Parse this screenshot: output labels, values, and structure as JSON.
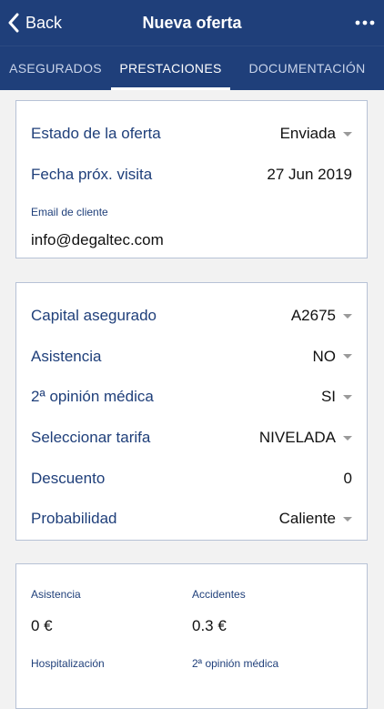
{
  "nav": {
    "back_label": "Back",
    "title": "Nueva oferta"
  },
  "tabs": [
    {
      "label": "ASEGURADOS",
      "active": false
    },
    {
      "label": "PRESTACIONES",
      "active": true
    },
    {
      "label": "DOCUMENTACIÓN",
      "active": false
    }
  ],
  "offer_card": {
    "estado_label": "Estado de la oferta",
    "estado_value": "Enviada",
    "fecha_label": "Fecha próx. visita",
    "fecha_value": "27 Jun 2019",
    "email_label": "Email de cliente",
    "email_value": "info@degaltec.com"
  },
  "benefits_card": {
    "rows": [
      {
        "label": "Capital asegurado",
        "value": "A2675",
        "dropdown": true
      },
      {
        "label": "Asistencia",
        "value": "NO",
        "dropdown": true
      },
      {
        "label": "2ª opinión médica",
        "value": "SI",
        "dropdown": true
      },
      {
        "label": "Seleccionar tarifa",
        "value": "NIVELADA",
        "dropdown": true
      },
      {
        "label": "Descuento",
        "value": "0",
        "dropdown": false
      },
      {
        "label": "Probabilidad",
        "value": "Caliente",
        "dropdown": true
      }
    ]
  },
  "summary_card": {
    "asistencia_label": "Asistencia",
    "asistencia_value": "0 €",
    "accidentes_label": "Accidentes",
    "accidentes_value": "0.3 €",
    "hospitalizacion_label": "Hospitalización",
    "segunda_opinion_label": "2ª opinión médica"
  },
  "colors": {
    "header": "#1f3f7a",
    "label": "#1f3f7a"
  }
}
